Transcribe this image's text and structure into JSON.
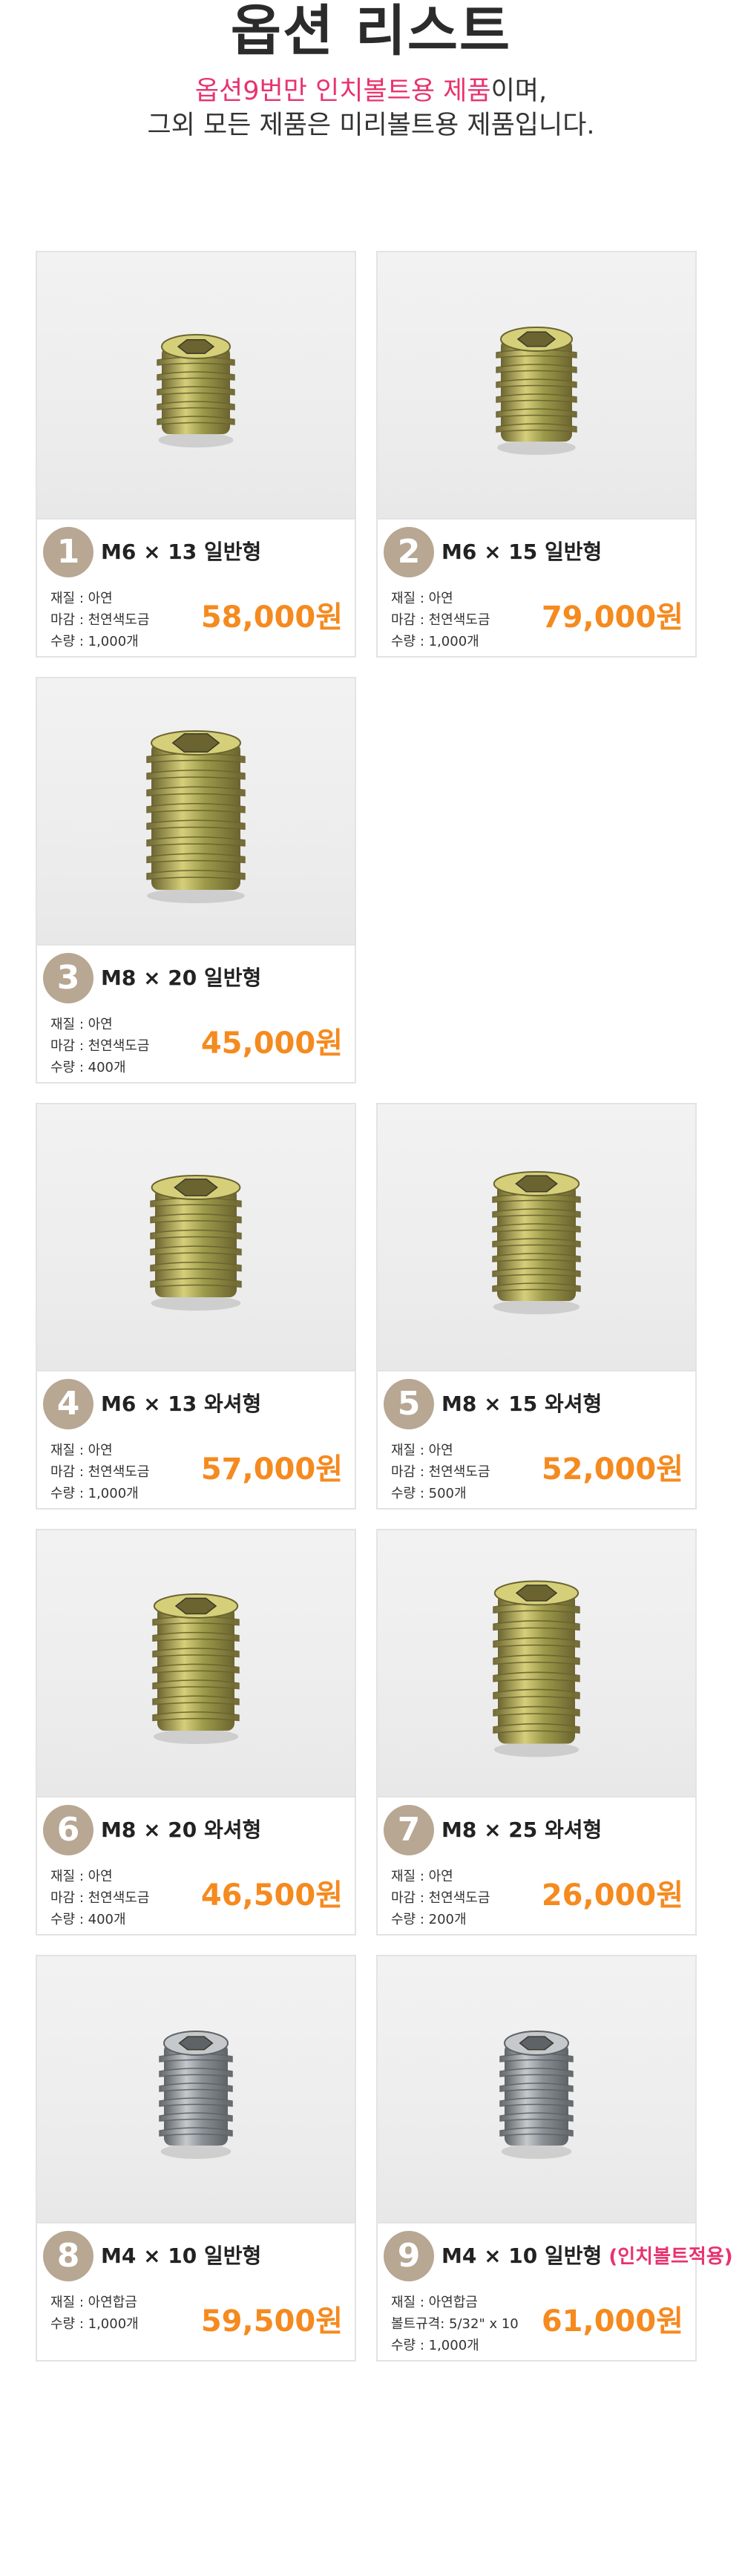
{
  "header": {
    "title": "옵션 리스트",
    "line1_highlight": "옵션9번만 인치볼트용 제품",
    "line1_rest": "이며,",
    "line2": "그외 모든 제품은 미리볼트용 제품입니다."
  },
  "products": [
    {
      "num": "1",
      "name": "M6 × 13 일반형",
      "note": "",
      "specs": [
        "재질 : 아연",
        "마감 : 천연색도금",
        "수량 : 1,000개"
      ],
      "price": "58,000원"
    },
    {
      "num": "2",
      "name": "M6 × 15 일반형",
      "note": "",
      "specs": [
        "재질 : 아연",
        "마감 : 천연색도금",
        "수량 : 1,000개"
      ],
      "price": "79,000원"
    },
    {
      "num": "3",
      "name": "M8 × 20 일반형",
      "note": "",
      "specs": [
        "재질 : 아연",
        "마감 : 천연색도금",
        "수량 : 400개"
      ],
      "price": "45,000원"
    },
    {
      "num": "4",
      "name": "M6 × 13 와셔형",
      "note": "",
      "specs": [
        "재질 : 아연",
        "마감 : 천연색도금",
        "수량 : 1,000개"
      ],
      "price": "57,000원"
    },
    {
      "num": "5",
      "name": "M8 × 15 와셔형",
      "note": "",
      "specs": [
        "재질 : 아연",
        "마감 : 천연색도금",
        "수량 : 500개"
      ],
      "price": "52,000원"
    },
    {
      "num": "6",
      "name": "M8 × 20 와셔형",
      "note": "",
      "specs": [
        "재질 : 아연",
        "마감 : 천연색도금",
        "수량 : 400개"
      ],
      "price": "46,500원"
    },
    {
      "num": "7",
      "name": "M8 × 25 와셔형",
      "note": "",
      "specs": [
        "재질 : 아연",
        "마감 : 천연색도금",
        "수량 : 200개"
      ],
      "price": "26,000원"
    },
    {
      "num": "8",
      "name": "M4 × 10 일반형",
      "note": "",
      "specs": [
        "재질 : 아연합금",
        "수량 : 1,000개"
      ],
      "price": "59,500원"
    },
    {
      "num": "9",
      "name": "M4 × 10 일반형",
      "note": "(인치볼트적용)",
      "specs": [
        "재질 : 아연합금",
        "볼트규격: 5/32\" x 10",
        "수량 : 1,000개"
      ],
      "price": "61,000원"
    }
  ],
  "colors": {
    "accent_pink": "#e8336e",
    "price_orange": "#f58a1f",
    "badge_beige": "#b7a793"
  },
  "images": [
    "brass-threaded-insert",
    "brass-threaded-insert",
    "brass-threaded-insert",
    "brass-flanged-insert",
    "brass-flanged-insert",
    "brass-flanged-insert",
    "brass-flanged-insert",
    "zinc-alloy-insert",
    "zinc-alloy-insert"
  ]
}
